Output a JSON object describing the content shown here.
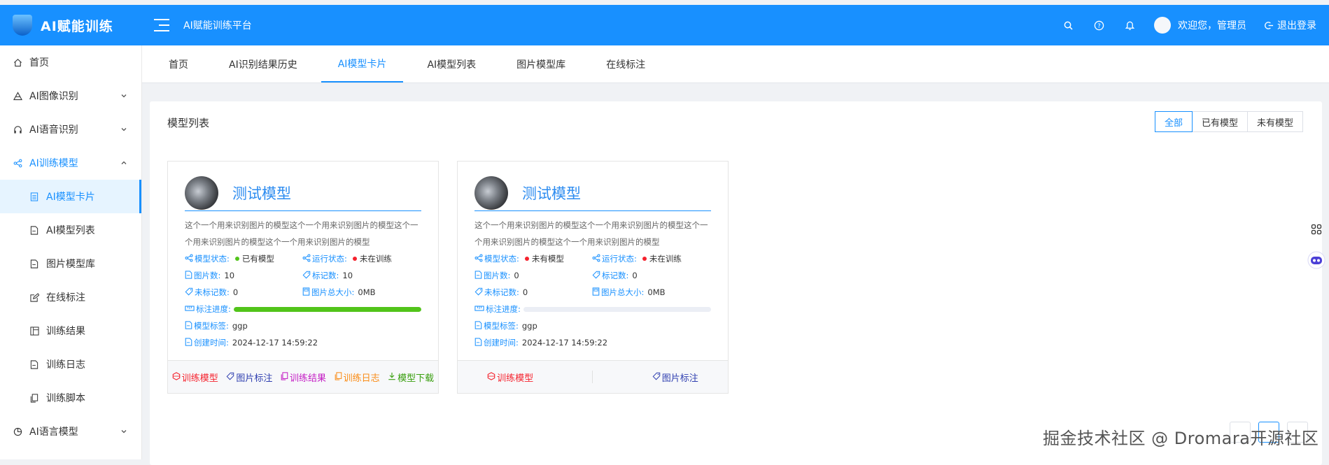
{
  "header": {
    "brand": "AI赋能训练",
    "platform_title": "AI赋能训练平台",
    "welcome": "欢迎您，管理员",
    "logout": "退出登录",
    "bg_color": "#1890ff"
  },
  "sidebar": {
    "items": [
      {
        "label": "首页",
        "icon": "home-icon"
      },
      {
        "label": "AI图像识别",
        "icon": "image-recognition-icon"
      },
      {
        "label": "AI语音识别",
        "icon": "headset-icon"
      },
      {
        "label": "AI训练模型",
        "icon": "share-icon"
      },
      {
        "label": "AI模型卡片",
        "icon": "card-icon"
      },
      {
        "label": "AI模型列表",
        "icon": "document-icon"
      },
      {
        "label": "图片模型库",
        "icon": "document-icon"
      },
      {
        "label": "在线标注",
        "icon": "edit-icon"
      },
      {
        "label": "训练结果",
        "icon": "table-icon"
      },
      {
        "label": "训练日志",
        "icon": "document-icon"
      },
      {
        "label": "训练脚本",
        "icon": "copy-icon"
      },
      {
        "label": "AI语言模型",
        "icon": "chart-pie-icon"
      }
    ]
  },
  "tabs": [
    "首页",
    "AI识别结果历史",
    "AI模型卡片",
    "AI模型列表",
    "图片模型库",
    "在线标注"
  ],
  "panel": {
    "title": "模型列表",
    "filters": [
      "全部",
      "已有模型",
      "未有模型"
    ]
  },
  "labels": {
    "model_status": "模型状态:",
    "run_status": "运行状态:",
    "image_count": "图片数:",
    "marked_count": "标记数:",
    "unmarked_count": "未标记数:",
    "image_size": "图片总大小:",
    "progress": "标注进度:",
    "tag": "模型标签:",
    "created": "创建时间:"
  },
  "cards": [
    {
      "name": "测试模型",
      "desc": "这个一个用来识别图片的模型这个一个用来识别图片的模型这个一个用来识别图片的模型这个一个用来识别图片的模型",
      "model_status": "已有模型",
      "model_status_color": "#52c41a",
      "run_status": "未在训练",
      "run_status_color": "#f5222d",
      "image_count": "10",
      "marked_count": "10",
      "unmarked_count": "0",
      "image_size": "0MB",
      "progress": 1.0,
      "tag": "ggp",
      "created": "2024-12-17 14:59:22",
      "actions": [
        {
          "label": "训练模型",
          "color": "#f5222d"
        },
        {
          "label": "图片标注",
          "color": "#2f3fb0"
        },
        {
          "label": "训练结果",
          "color": "#c41dc4"
        },
        {
          "label": "训练日志",
          "color": "#fa8c16"
        },
        {
          "label": "模型下载",
          "color": "#389e0d"
        }
      ]
    },
    {
      "name": "测试模型",
      "desc": "这个一个用来识别图片的模型这个一个用来识别图片的模型这个一个用来识别图片的模型这个一个用来识别图片的模型",
      "model_status": "未有模型",
      "model_status_color": "#f5222d",
      "run_status": "未在训练",
      "run_status_color": "#f5222d",
      "image_count": "0",
      "marked_count": "0",
      "unmarked_count": "0",
      "image_size": "0MB",
      "progress": 0,
      "tag": "ggp",
      "created": "2024-12-17 14:59:22",
      "actions": [
        {
          "label": "训练模型",
          "color": "#f5222d"
        },
        {
          "label": "图片标注",
          "color": "#2f3fb0"
        }
      ]
    }
  ],
  "watermark": "掘金技术社区 @ Dromara开源社区"
}
